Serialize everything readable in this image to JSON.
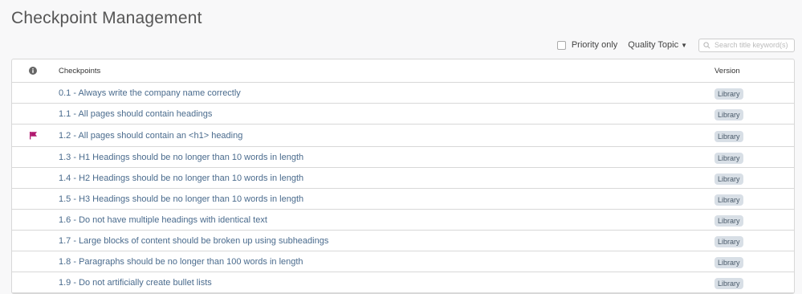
{
  "page": {
    "title": "Checkpoint Management"
  },
  "toolbar": {
    "priority_label": "Priority only",
    "topic_label": "Quality Topic",
    "search_placeholder": "Search title keyword(s)"
  },
  "table": {
    "header_checkpoints": "Checkpoints",
    "header_version": "Version",
    "rows": [
      {
        "title": "0.1 - Always write the company name correctly",
        "version": "Library",
        "flagged": false
      },
      {
        "title": "1.1 - All pages should contain headings",
        "version": "Library",
        "flagged": false
      },
      {
        "title": "1.2 - All pages should contain an <h1> heading",
        "version": "Library",
        "flagged": true
      },
      {
        "title": "1.3 - H1 Headings should be no longer than 10 words in length",
        "version": "Library",
        "flagged": false
      },
      {
        "title": "1.4 - H2 Headings should be no longer than 10 words in length",
        "version": "Library",
        "flagged": false
      },
      {
        "title": "1.5 - H3 Headings should be no longer than 10 words in length",
        "version": "Library",
        "flagged": false
      },
      {
        "title": "1.6 - Do not have multiple headings with identical text",
        "version": "Library",
        "flagged": false
      },
      {
        "title": "1.7 - Large blocks of content should be broken up using subheadings",
        "version": "Library",
        "flagged": false
      },
      {
        "title": "1.8 - Paragraphs should be no longer than 100 words in length",
        "version": "Library",
        "flagged": false
      },
      {
        "title": "1.9 - Do not artificially create bullet lists",
        "version": "Library",
        "flagged": false
      }
    ]
  },
  "colors": {
    "link": "#4a6b8d",
    "flag": "#b0186e",
    "badge_bg": "#d8dfe6"
  },
  "icons": {
    "header": "info-icon",
    "flag": "flag-icon",
    "search": "search-icon",
    "dropdown": "caret-down-icon"
  }
}
